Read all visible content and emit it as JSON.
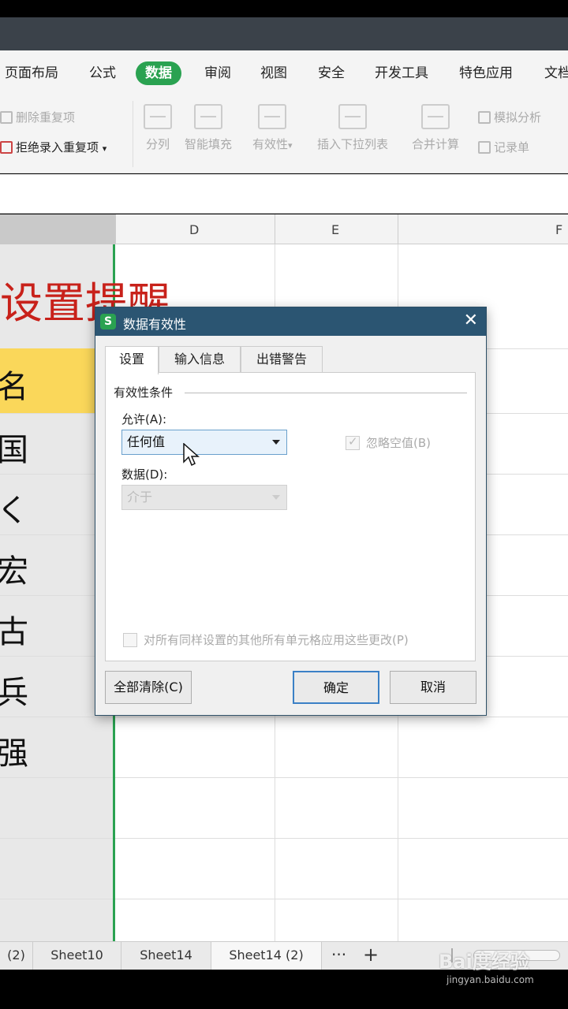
{
  "ribbon": {
    "tabs": [
      "页面布局",
      "公式",
      "数据",
      "审阅",
      "视图",
      "安全",
      "开发工具",
      "特色应用",
      "文档"
    ],
    "active_tab": "数据"
  },
  "toolbar": {
    "remove_duplicates": "删除重复项",
    "reject_duplicates": "拒绝录入重复项",
    "split": "分列",
    "smart_fill": "智能填充",
    "validity": "有效性",
    "insert_dropdown": "插入下拉列表",
    "consolidate": "合并计算",
    "simulate": "模拟分析",
    "record": "记录单"
  },
  "columns": [
    "D",
    "E",
    "F"
  ],
  "sheet": {
    "title": "设置提醒",
    "cells": [
      "名",
      "国",
      "く",
      "宏",
      "古",
      "兵",
      "强"
    ]
  },
  "dialog": {
    "title": "数据有效性",
    "logo": "S",
    "close": "✕",
    "tabs": [
      "设置",
      "输入信息",
      "出错警告"
    ],
    "group_label": "有效性条件",
    "allow_label": "允许(A):",
    "allow_value": "任何值",
    "ignore_blank": "忽略空值(B)",
    "data_label": "数据(D):",
    "data_value": "介于",
    "apply_all": "对所有同样设置的其他所有单元格应用这些更改(P)",
    "clear_all": "全部清除(C)",
    "ok": "确定",
    "cancel": "取消"
  },
  "sheet_tabs": {
    "tabs": [
      "(2)",
      "Sheet10",
      "Sheet14",
      "Sheet14 (2)"
    ],
    "more": "···",
    "add": "+"
  },
  "watermark": {
    "text": "Bai度经验",
    "sub": "jingyan.baidu.com"
  }
}
